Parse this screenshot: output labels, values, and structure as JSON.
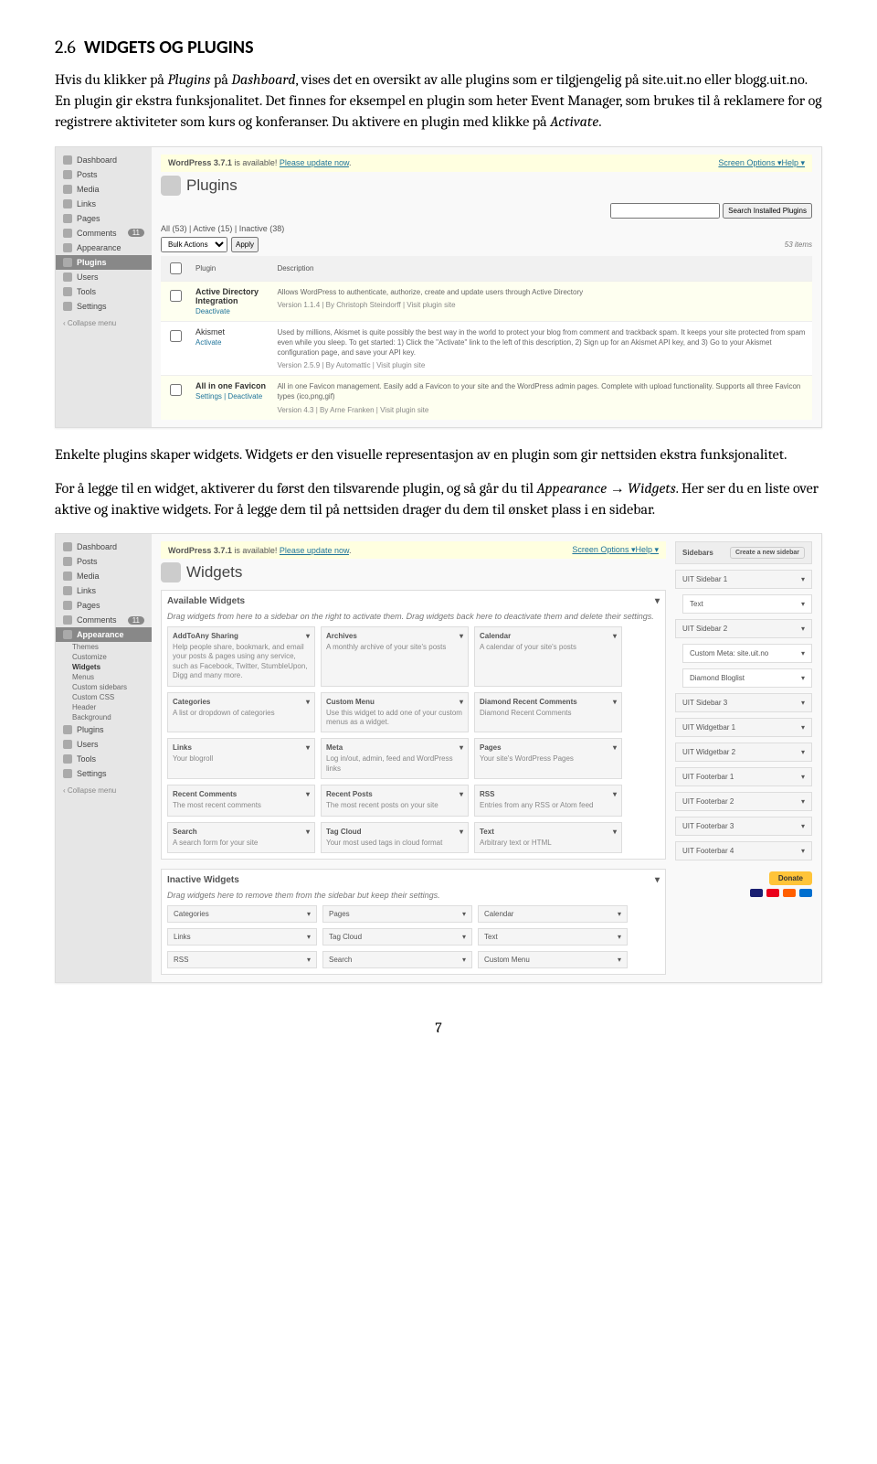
{
  "heading": {
    "num": "2.6",
    "title": "WIDGETS OG PLUGINS"
  },
  "para1_a": "Hvis du klikker på ",
  "para1_b": " på ",
  "para1_c": ", vises det en oversikt av alle plugins som er tilgjengelig på site.uit.no eller blogg.uit.no. En plugin gir ekstra funksjonalitet. Det finnes for eksempel en plugin som heter Event Manager, som brukes til å reklamere for og registrere aktiviteter som kurs og konferanser. Du aktivere en plugin med klikke på ",
  "para1_d": ".",
  "plugins_word": "Plugins",
  "dashboard_word": "Dashboard",
  "activate_word": "Activate",
  "para2": "Enkelte plugins skaper widgets. Widgets er den visuelle representasjon av en plugin som gir nettsiden ekstra funksjonalitet.",
  "para3_a": "For å legge til en widget, aktiverer du først den tilsvarende plugin, og så går du til ",
  "para3_b": ". Her ser du en liste over aktive og inaktive widgets. For å legge dem til på nettsiden drager du dem til ønsket plass i en sidebar.",
  "appearance_word": "Appearance",
  "widgets_word": "Widgets",
  "arrow": "→",
  "pagenum": "7",
  "wp": {
    "notice_a": "WordPress 3.7.1",
    "notice_b": " is available! ",
    "notice_link": "Please update now",
    "screen_options": "Screen Options ▾",
    "help": "Help ▾",
    "menu": {
      "dashboard": "Dashboard",
      "posts": "Posts",
      "media": "Media",
      "links": "Links",
      "pages": "Pages",
      "comments": "Comments",
      "comment_count": "11",
      "appearance": "Appearance",
      "plugins": "Plugins",
      "users": "Users",
      "tools": "Tools",
      "settings": "Settings",
      "collapse": "‹ Collapse menu"
    },
    "plugins_page": {
      "title": "Plugins",
      "search_btn": "Search Installed Plugins",
      "subsub": "All (53) | Active (15) | Inactive (38)",
      "bulk": "Bulk Actions",
      "apply": "Apply",
      "items": "53 items",
      "col_plugin": "Plugin",
      "col_desc": "Description",
      "rows": [
        {
          "name": "Active Directory Integration",
          "links": "Deactivate",
          "active": true,
          "desc": "Allows WordPress to authenticate, authorize, create and update users through Active Directory",
          "ver": "Version 1.1.4 | By Christoph Steindorff | Visit plugin site"
        },
        {
          "name": "Akismet",
          "links": "Activate",
          "active": false,
          "desc": "Used by millions, Akismet is quite possibly the best way in the world to protect your blog from comment and trackback spam. It keeps your site protected from spam even while you sleep. To get started: 1) Click the \"Activate\" link to the left of this description, 2) Sign up for an Akismet API key, and 3) Go to your Akismet configuration page, and save your API key.",
          "ver": "Version 2.5.9 | By Automattic | Visit plugin site"
        },
        {
          "name": "All in one Favicon",
          "links": "Settings | Deactivate",
          "active": true,
          "desc": "All in one Favicon management. Easily add a Favicon to your site and the WordPress admin pages. Complete with upload functionality. Supports all three Favicon types (ico,png,gif)",
          "ver": "Version 4.3 | By Arne Franken | Visit plugin site"
        }
      ]
    },
    "widgets_page": {
      "title": "Widgets",
      "avail_title": "Available Widgets",
      "avail_desc": "Drag widgets from here to a sidebar on the right to activate them. Drag widgets back here to deactivate them and delete their settings.",
      "widgets": [
        {
          "t": "AddToAny Sharing",
          "d": "Help people share, bookmark, and email your posts & pages using any service, such as Facebook, Twitter, StumbleUpon, Digg and many more."
        },
        {
          "t": "Archives",
          "d": "A monthly archive of your site's posts"
        },
        {
          "t": "Calendar",
          "d": "A calendar of your site's posts"
        },
        {
          "t": "Categories",
          "d": "A list or dropdown of categories"
        },
        {
          "t": "Custom Menu",
          "d": "Use this widget to add one of your custom menus as a widget."
        },
        {
          "t": "Diamond Recent Comments",
          "d": "Diamond Recent Comments"
        },
        {
          "t": "Links",
          "d": "Your blogroll"
        },
        {
          "t": "Meta",
          "d": "Log in/out, admin, feed and WordPress links"
        },
        {
          "t": "Pages",
          "d": "Your site's WordPress Pages"
        },
        {
          "t": "Recent Comments",
          "d": "The most recent comments"
        },
        {
          "t": "Recent Posts",
          "d": "The most recent posts on your site"
        },
        {
          "t": "RSS",
          "d": "Entries from any RSS or Atom feed"
        },
        {
          "t": "Search",
          "d": "A search form for your site"
        },
        {
          "t": "Tag Cloud",
          "d": "Your most used tags in cloud format"
        },
        {
          "t": "Text",
          "d": "Arbitrary text or HTML"
        }
      ],
      "inactive_title": "Inactive Widgets",
      "inactive_desc": "Drag widgets here to remove them from the sidebar but keep their settings.",
      "inactive": [
        "Categories",
        "Pages",
        "Calendar",
        "Links",
        "Tag Cloud",
        "Text",
        "RSS",
        "Search",
        "Custom Menu"
      ],
      "sidebars_title": "Sidebars",
      "create_new": "Create a new sidebar",
      "sb": [
        {
          "n": "UIT Sidebar 1",
          "items": [
            "Text"
          ]
        },
        {
          "n": "UIT Sidebar 2",
          "items": [
            "Custom Meta: site.uit.no",
            "Diamond Bloglist"
          ]
        },
        {
          "n": "UIT Sidebar 3"
        },
        {
          "n": "UIT Widgetbar 1"
        },
        {
          "n": "UIT Widgetbar 2"
        },
        {
          "n": "UIT Footerbar 1"
        },
        {
          "n": "UIT Footerbar 2"
        },
        {
          "n": "UIT Footerbar 3"
        },
        {
          "n": "UIT Footerbar 4"
        }
      ],
      "sub_appearance": [
        "Themes",
        "Customize",
        "Widgets",
        "Menus",
        "Custom sidebars",
        "Custom CSS",
        "Header",
        "Background"
      ],
      "donate": "Donate"
    }
  }
}
